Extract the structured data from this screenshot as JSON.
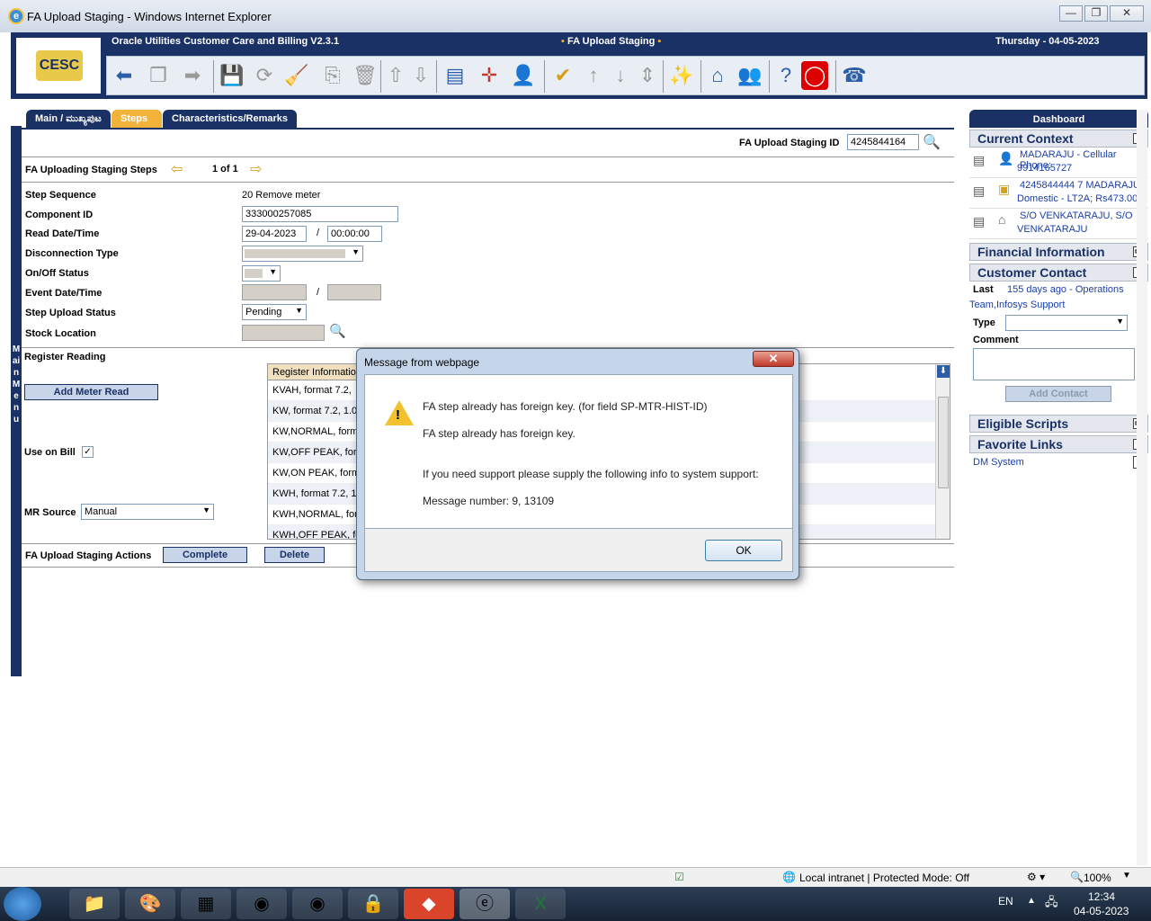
{
  "window": {
    "title": "FA Upload Staging - Windows Internet Explorer",
    "min": "—",
    "max": "❐",
    "close": "✕"
  },
  "header": {
    "app_name": "Oracle Utilities Customer Care and Billing V2.3.1",
    "page_name": "FA Upload Staging",
    "date": "Thursday - 04-05-2023"
  },
  "tabs": [
    "Main / ಮುಖ್ಯಪುಟ",
    "Steps",
    "Characteristics/Remarks"
  ],
  "left_menu_label": "Main Menu",
  "form": {
    "id_label": "FA Upload Staging ID",
    "id_value": "4245844164",
    "steps_label": "FA Uploading Staging Steps",
    "steps_page": "1 of 1",
    "step_sequence_label": "Step Sequence",
    "step_sequence_value": "20 Remove meter",
    "component_id_label": "Component ID",
    "component_id_value": "333000257085",
    "read_date_label": "Read Date/Time",
    "read_date_value": "29-04-2023",
    "read_time_value": "00:00:00",
    "disconnection_type_label": "Disconnection Type",
    "onoff_label": "On/Off Status",
    "event_date_label": "Event Date/Time",
    "step_upload_status_label": "Step Upload Status",
    "step_upload_status_value": "Pending",
    "stock_location_label": "Stock Location",
    "register_reading_label": "Register Reading",
    "add_meter_read": "Add Meter Read",
    "use_on_bill_label": "Use on Bill",
    "mr_source_label": "MR Source",
    "mr_source_value": "Manual",
    "actions_label": "FA Upload Staging Actions",
    "complete": "Complete",
    "delete": "Delete",
    "slash": "/"
  },
  "register_table": {
    "header": "Register Informatio",
    "rows": [
      "KVAH, format 7.2,",
      "KW, format 7.2, 1.0",
      "KW,NORMAL, form",
      "KW,OFF PEAK, forr",
      "KW,ON PEAK, form",
      "KWH, format 7.2, 1",
      "KWH,NORMAL, forr",
      "KWH,OFF PEAK, for"
    ]
  },
  "dashboard": {
    "title": "Dashboard",
    "current_context": "Current Context",
    "ctx1_line1": "MADARAJU - Cellular Phone:",
    "ctx1_line2": "9914165727",
    "ctx2_line1": "4245844444 7 MADARAJU;",
    "ctx2_line2": "Domestic - LT2A; Rs473.00;",
    "ctx3_line1": "S/O VENKATARAJU, S/O",
    "ctx3_line2": "VENKATARAJU",
    "financial_information": "Financial Information",
    "customer_contact": "Customer Contact",
    "last_label": "Last",
    "last_value_1": "155 days ago - Operations",
    "last_value_2": "Team,Infosys Support",
    "type_label": "Type",
    "comment_label": "Comment",
    "add_contact": "Add Contact",
    "eligible_scripts": "Eligible Scripts",
    "favorite_links": "Favorite Links",
    "dm_system": "DM System",
    "fav_count": "1"
  },
  "dialog": {
    "title": "Message from webpage",
    "line1": "FA step already has foreign key. (for field SP-MTR-HIST-ID)",
    "line2": "FA step already has foreign key.",
    "line3": "If you need support please supply the following info to system support:",
    "line4": "Message number: 9, 13109",
    "ok": "OK"
  },
  "statusbar": {
    "zone": "Local intranet | Protected Mode: Off",
    "zoom": "100%"
  },
  "taskbar": {
    "lang": "EN",
    "time": "12:34",
    "date": "04-05-2023"
  },
  "colors": {
    "navy": "#1a3166",
    "accent": "#f3b23a",
    "link": "#1a3ea8"
  }
}
